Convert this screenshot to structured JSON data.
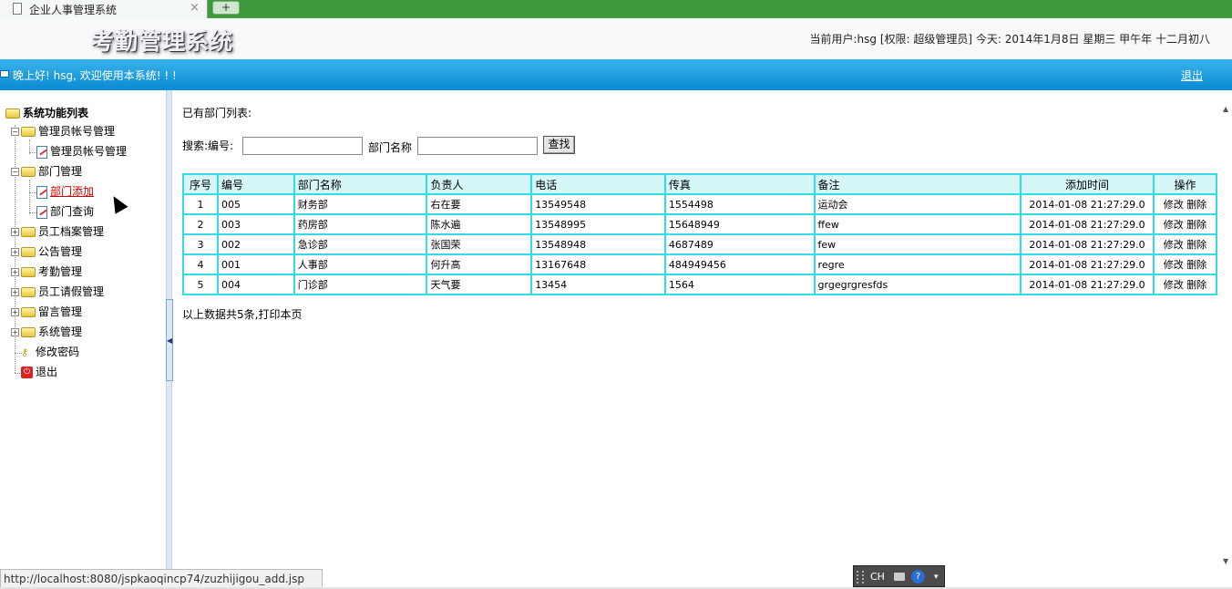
{
  "browser": {
    "tab_title": "企业人事管理系统",
    "tab_close": "×",
    "new_tab": "+",
    "status_url": "http://localhost:8080/jspkaoqincp74/zuzhijigou_add.jsp"
  },
  "header": {
    "system_title": "考勤管理系统",
    "user_info": "当前用户:hsg [权限: 超级管理员] 今天: 2014年1月8日 星期三 甲午年 十二月初八"
  },
  "banner": {
    "welcome": "晚上好! hsg, 欢迎使用本系统! ! !",
    "logout": "退出"
  },
  "sidebar": {
    "root": "系统功能列表",
    "items": [
      {
        "label": "管理员帐号管理",
        "type": "folder",
        "expanded": true
      },
      {
        "label": "管理员帐号管理",
        "type": "page"
      },
      {
        "label": "部门管理",
        "type": "folder",
        "expanded": true
      },
      {
        "label": "部门添加",
        "type": "page",
        "active": true
      },
      {
        "label": "部门查询",
        "type": "page"
      },
      {
        "label": "员工档案管理",
        "type": "folder"
      },
      {
        "label": "公告管理",
        "type": "folder"
      },
      {
        "label": "考勤管理",
        "type": "folder"
      },
      {
        "label": "员工请假管理",
        "type": "folder"
      },
      {
        "label": "留言管理",
        "type": "folder"
      },
      {
        "label": "系统管理",
        "type": "folder"
      },
      {
        "label": "修改密码",
        "type": "key"
      },
      {
        "label": "退出",
        "type": "exit"
      }
    ]
  },
  "main": {
    "list_title": "已有部门列表:",
    "search_label_id": "搜索:编号:",
    "search_label_name": "部门名称",
    "search_id_value": "",
    "search_name_value": "",
    "search_button": "查找",
    "table": {
      "headers": [
        "序号",
        "编号",
        "部门名称",
        "负责人",
        "电话",
        "传真",
        "备注",
        "添加时间",
        "操作"
      ],
      "rows": [
        {
          "no": "1",
          "code": "005",
          "name": "财务部",
          "manager": "右在要",
          "phone": "13549548",
          "fax": "1554498",
          "remark": "运动会",
          "time": "2014-01-08 21:27:29.0",
          "edit": "修改",
          "delete": "删除"
        },
        {
          "no": "2",
          "code": "003",
          "name": "药房部",
          "manager": "陈水遍",
          "phone": "13548995",
          "fax": "15648949",
          "remark": "ffew",
          "time": "2014-01-08 21:27:29.0",
          "edit": "修改",
          "delete": "删除"
        },
        {
          "no": "3",
          "code": "002",
          "name": "急诊部",
          "manager": "张国荣",
          "phone": "13548948",
          "fax": "4687489",
          "remark": "few",
          "time": "2014-01-08 21:27:29.0",
          "edit": "修改",
          "delete": "删除"
        },
        {
          "no": "4",
          "code": "001",
          "name": "人事部",
          "manager": "何升高",
          "phone": "13167648",
          "fax": "484949456",
          "remark": "regre",
          "time": "2014-01-08 21:27:29.0",
          "edit": "修改",
          "delete": "删除"
        },
        {
          "no": "5",
          "code": "004",
          "name": "门诊部",
          "manager": "天气要",
          "phone": "13454",
          "fax": "1564",
          "remark": "grgegrgresfds",
          "time": "2014-01-08 21:27:29.0",
          "edit": "修改",
          "delete": "删除"
        }
      ]
    },
    "summary_prefix": "以上数据共5条,",
    "print_link": "打印本页"
  },
  "ime": {
    "lang": "CH",
    "help": "?"
  }
}
